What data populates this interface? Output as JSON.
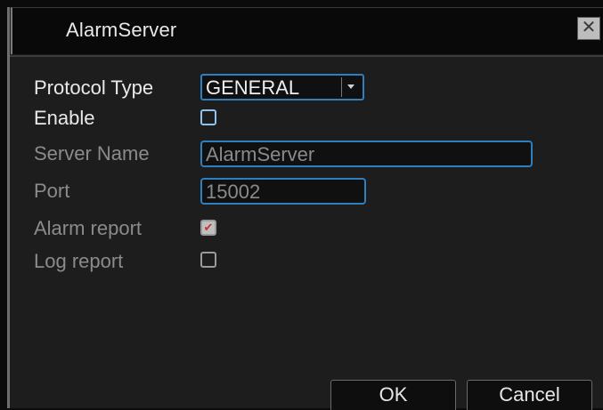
{
  "window": {
    "title": "AlarmServer",
    "close_glyph": "✕"
  },
  "form": {
    "protocol_type": {
      "label": "Protocol Type",
      "value": "GENERAL"
    },
    "enable": {
      "label": "Enable",
      "checked": false
    },
    "server_name": {
      "label": "Server Name",
      "value": "AlarmServer"
    },
    "port": {
      "label": "Port",
      "value": "15002"
    },
    "alarm_report": {
      "label": "Alarm report",
      "checked": true,
      "check_glyph": "✔"
    },
    "log_report": {
      "label": "Log report",
      "checked": false
    }
  },
  "buttons": {
    "ok": "OK",
    "cancel": "Cancel"
  },
  "colors": {
    "accent_border": "#2f7fbf",
    "background": "#1d1d1d",
    "check_mark": "#d03030"
  },
  "icons": {
    "close": "close-icon",
    "dropdown": "chevron-down-icon",
    "check": "check-icon"
  }
}
